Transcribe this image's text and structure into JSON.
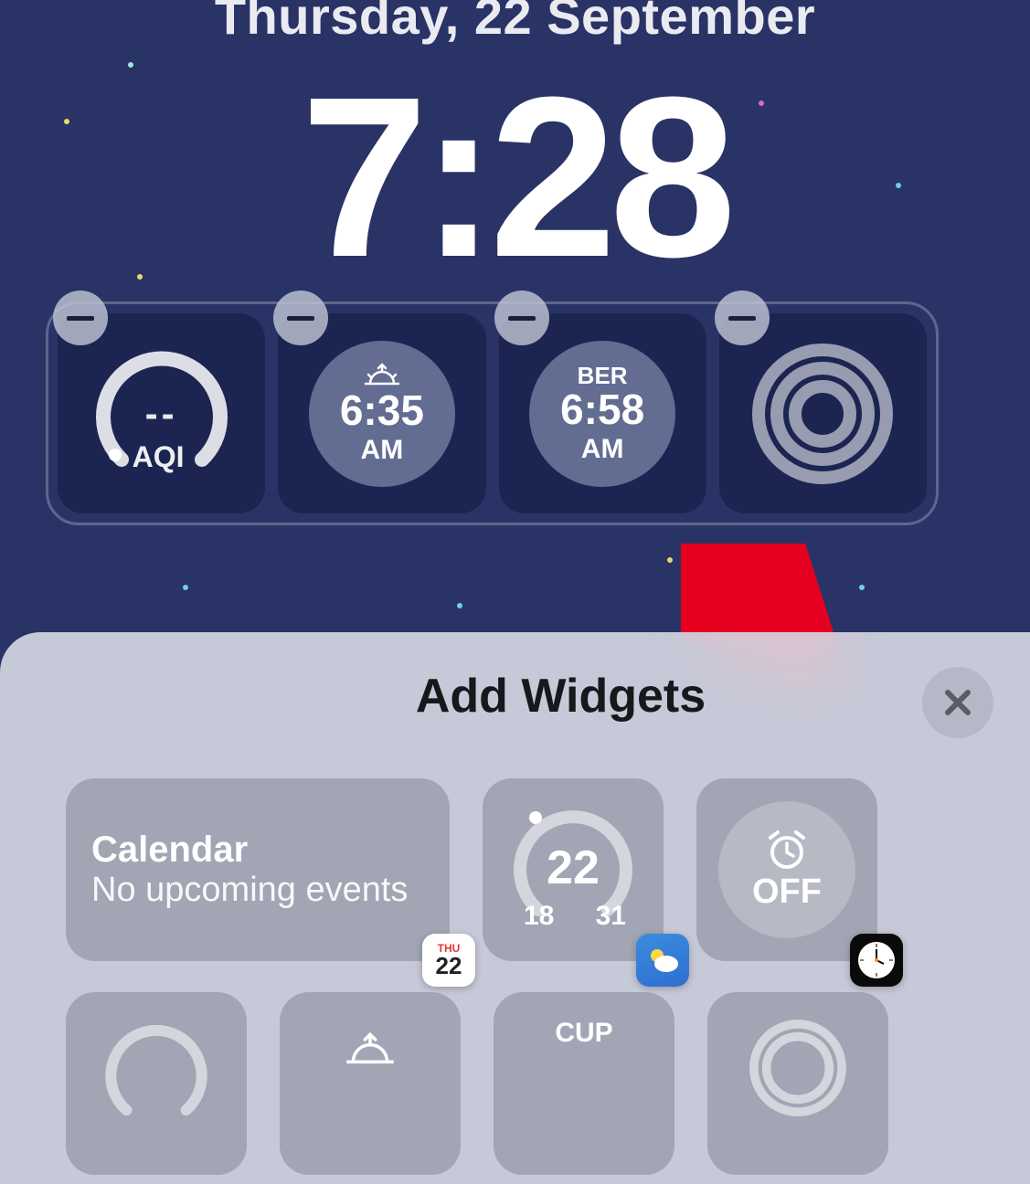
{
  "lockscreen": {
    "date": "Thursday, 22 September",
    "time": "7:28"
  },
  "widgets": {
    "aqi": {
      "value": "--",
      "label": "AQI"
    },
    "sunrise": {
      "time": "6:35",
      "period": "AM"
    },
    "cityClock": {
      "city": "BER",
      "time": "6:58",
      "period": "AM"
    }
  },
  "sheet": {
    "title": "Add Widgets",
    "calendar": {
      "title": "Calendar",
      "subtitle": "No upcoming events",
      "badgeDay": "THU",
      "badgeDate": "22"
    },
    "weather": {
      "temp": "22",
      "low": "18",
      "high": "31"
    },
    "alarm": {
      "state": "OFF"
    },
    "row2": {
      "cup": "CUP"
    }
  }
}
